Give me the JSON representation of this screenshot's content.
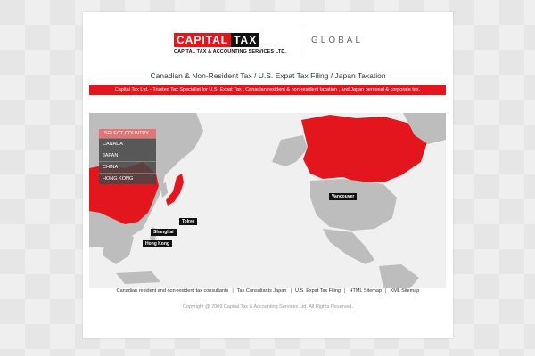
{
  "logo": {
    "capital": "CAPITAL",
    "tax": "TAX",
    "subtitle": "CAPITAL TAX & ACCOUNTING SERVICES LTD.",
    "global": "GLOBAL"
  },
  "heading": "Canadian & Non-Resident Tax / U.S. Expat Tax Filing / Japan Taxation",
  "banner": "Capital Tax Ltd. - Trusted Tax Specialist for U.S. Expat Tax , Canadian resident & non-resident taxation , and Japan personal & corporate tax.",
  "map": {
    "select_header": "SELECT COUNTRY",
    "countries": [
      "CANADA",
      "JAPAN",
      "CHINA",
      "HONG KONG"
    ],
    "cities": {
      "vancouver": "Vancouver",
      "tokyo": "Tokyo",
      "shanghai": "Shanghai",
      "hongkong": "Hong Kong"
    },
    "colors": {
      "highlight": "#e3161d",
      "land": "#bdbdbd",
      "ocean": "#f0f0f0"
    }
  },
  "footer": {
    "links": [
      "Canadian resident and non-resident tax consultants",
      "Tax Consultants Japan",
      "U.S. Expat Tax Filing",
      "HTML Sitemap",
      "XML Sitemap"
    ],
    "copyright": "Copyright @ 2009 Capital Tax & Accounting Services Ltd. All Rights Reserved."
  }
}
